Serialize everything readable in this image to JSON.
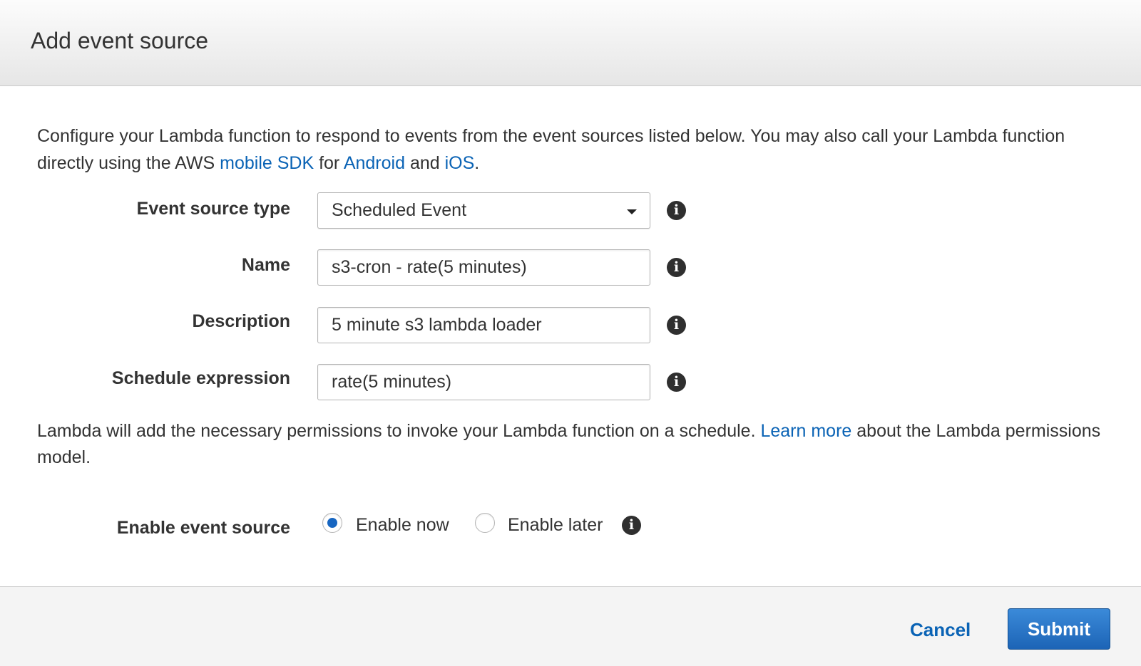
{
  "dialog": {
    "title": "Add event source"
  },
  "intro": {
    "text_part1": "Configure your Lambda function to respond to events from the event sources listed below. You may also call your Lambda function directly using the AWS ",
    "link_mobile_sdk": "mobile SDK",
    "text_for": " for ",
    "link_android": "Android",
    "text_and": " and ",
    "link_ios": "iOS",
    "text_end": "."
  },
  "form": {
    "event_source_type": {
      "label": "Event source type",
      "value": "Scheduled Event"
    },
    "name": {
      "label": "Name",
      "value": "s3-cron - rate(5 minutes)"
    },
    "description": {
      "label": "Description",
      "value": "5 minute s3 lambda loader"
    },
    "schedule_expression": {
      "label": "Schedule expression",
      "value": "rate(5 minutes)"
    },
    "enable_event_source": {
      "label": "Enable event source",
      "options": [
        "Enable now",
        "Enable later"
      ],
      "selected": "Enable now"
    }
  },
  "permissions_note": {
    "text_part1": "Lambda will add the necessary permissions to invoke your Lambda function on a schedule. ",
    "link_learn_more": "Learn more",
    "text_part2": " about the Lambda permissions model."
  },
  "footer": {
    "cancel_label": "Cancel",
    "submit_label": "Submit"
  },
  "icons": {
    "info": "info-icon",
    "dropdown": "chevron-down-icon"
  },
  "colors": {
    "link": "#0a63b5",
    "primary_button": "#1c64b6",
    "radio_selected": "#1766c1"
  }
}
